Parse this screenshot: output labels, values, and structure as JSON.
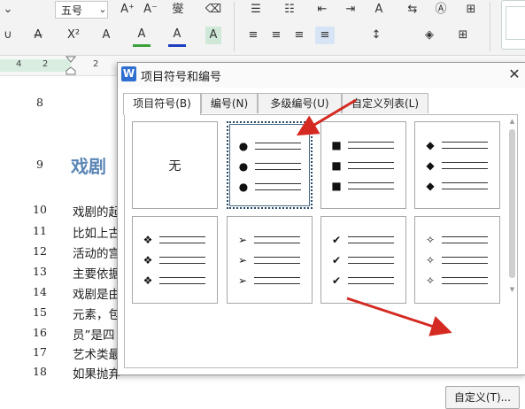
{
  "ribbon": {
    "font_size_value": "五号",
    "row1": [
      "A⁺",
      "A⁻",
      "燮",
      "⌫",
      "☰",
      "☷",
      "⇤",
      "⇥",
      "A",
      "⇆",
      "Ⓐ",
      "⊞"
    ],
    "row2": [
      "∪",
      "A",
      "X²",
      "A",
      "A",
      "A",
      "A",
      "≡",
      "≡",
      "≡",
      "≡",
      "↕",
      "◈",
      "⊞"
    ],
    "colors": {
      "highlight": "#3aa23a",
      "font_color": "#1d3fbf"
    }
  },
  "ruler": {
    "nums": [
      "4",
      "2",
      "2"
    ]
  },
  "document": {
    "heading": "戏剧",
    "lines": [
      {
        "num": "8",
        "text": ""
      },
      {
        "num": "9",
        "text": ""
      },
      {
        "num": "10",
        "text": "戏剧的起"
      },
      {
        "num": "11",
        "text": "比如上古"
      },
      {
        "num": "12",
        "text": "活动的宫"
      },
      {
        "num": "13",
        "text": "主要依据"
      },
      {
        "num": "14",
        "text": "戏剧是由"
      },
      {
        "num": "15",
        "text": "元素，包"
      },
      {
        "num": "16",
        "text": "员”是四"
      },
      {
        "num": "17",
        "text": "艺术类最"
      },
      {
        "num": "18",
        "text": "如果抛弃"
      }
    ]
  },
  "dialog": {
    "logo": "W",
    "title": "项目符号和编号",
    "close_icon": "✕",
    "tabs": [
      {
        "label": "项目符号(B)",
        "active": true
      },
      {
        "label": "编号(N)",
        "active": false
      },
      {
        "label": "多级编号(U)",
        "active": false
      },
      {
        "label": "自定义列表(L)",
        "active": false
      }
    ],
    "none_label": "无",
    "bullet_styles": [
      {
        "name": "none",
        "symbol": ""
      },
      {
        "name": "filled-circle",
        "symbol": "●",
        "selected": true
      },
      {
        "name": "filled-square",
        "symbol": "■"
      },
      {
        "name": "filled-diamond",
        "symbol": "◆"
      },
      {
        "name": "four-diamond",
        "symbol": "❖"
      },
      {
        "name": "arrowhead",
        "symbol": "➢"
      },
      {
        "name": "checkmark",
        "symbol": "✔"
      },
      {
        "name": "star-4",
        "symbol": "✧"
      }
    ],
    "custom_button": "自定义(T)...",
    "scroll_up": "▲",
    "scroll_down": "▼"
  },
  "annotation_color": "#d42a21"
}
